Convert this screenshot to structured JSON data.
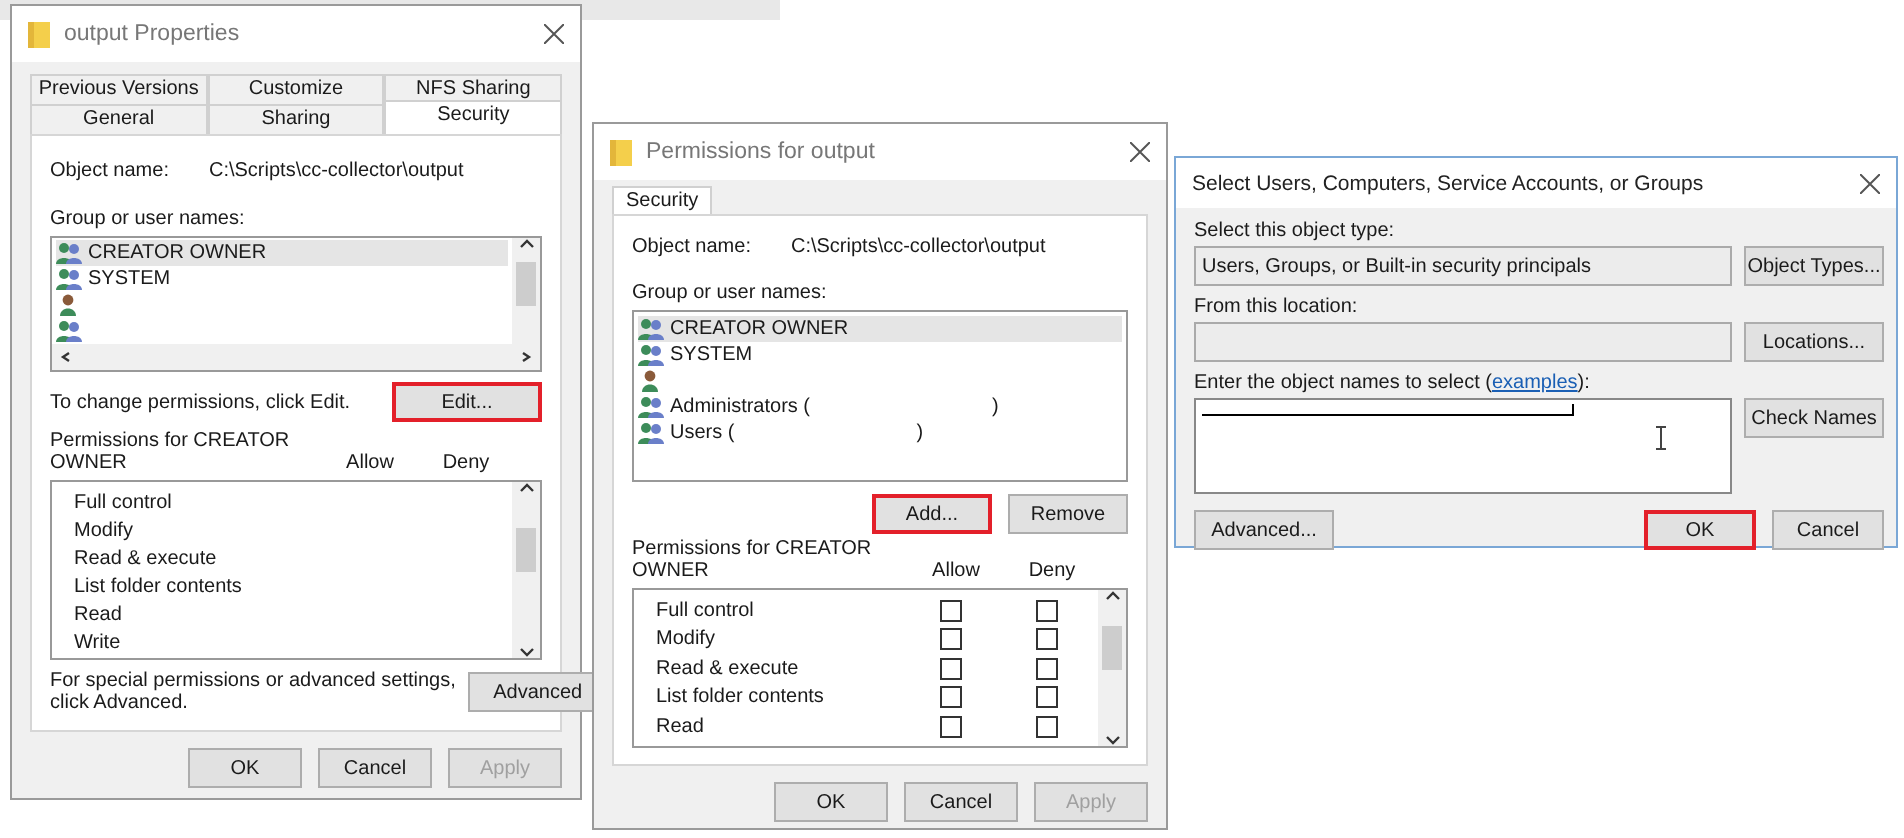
{
  "properties_dialog": {
    "title": "output Properties",
    "tab_rows": [
      [
        {
          "label": "Previous Versions",
          "selected": false
        },
        {
          "label": "Customize",
          "selected": false
        },
        {
          "label": "NFS Sharing",
          "selected": false
        }
      ],
      [
        {
          "label": "General",
          "selected": false
        },
        {
          "label": "Sharing",
          "selected": false
        },
        {
          "label": "Security",
          "selected": true
        }
      ]
    ],
    "object_name_label": "Object name:",
    "object_name": "C:\\Scripts\\cc-collector\\output",
    "group_label": "Group or user names:",
    "principals": [
      {
        "kind": "group",
        "name": "CREATOR OWNER",
        "selected": true
      },
      {
        "kind": "group",
        "name": "SYSTEM",
        "selected": false
      },
      {
        "kind": "user",
        "selected": false
      },
      {
        "kind": "group",
        "selected": false
      }
    ],
    "change_hint": "To change permissions, click Edit.",
    "edit_button": {
      "label": "Edit...",
      "highlighted": true
    },
    "permissions_label": "Permissions for CREATOR\nOWNER",
    "allow_header": "Allow",
    "deny_header": "Deny",
    "permissions": [
      {
        "name": "Full control"
      },
      {
        "name": "Modify"
      },
      {
        "name": "Read & execute"
      },
      {
        "name": "List folder contents"
      },
      {
        "name": "Read"
      },
      {
        "name": "Write"
      }
    ],
    "advanced_hint": "For special permissions or advanced settings,\nclick Advanced.",
    "advanced_button": "Advanced",
    "buttons": [
      {
        "label": "OK",
        "disabled": false
      },
      {
        "label": "Cancel",
        "disabled": false
      },
      {
        "label": "Apply",
        "disabled": true
      }
    ]
  },
  "permissions_dialog": {
    "title": "Permissions for output",
    "tab": {
      "label": "Security",
      "selected": true
    },
    "object_name_label": "Object name:",
    "object_name": "C:\\Scripts\\cc-collector\\output",
    "group_label": "Group or user names:",
    "principals": [
      {
        "kind": "group",
        "name": "CREATOR OWNER",
        "selected": true
      },
      {
        "kind": "group",
        "name": "SYSTEM",
        "selected": false
      },
      {
        "kind": "user",
        "selected": false
      },
      {
        "kind": "group",
        "name": "Administrators (",
        "name_end": ")",
        "selected": false
      },
      {
        "kind": "group",
        "name": "Users (",
        "name_end": ")",
        "selected": false
      }
    ],
    "add_button": {
      "label": "Add...",
      "highlighted": true
    },
    "remove_button": {
      "label": "Remove",
      "highlighted": false
    },
    "permissions_label": "Permissions for CREATOR\nOWNER",
    "allow_header": "Allow",
    "deny_header": "Deny",
    "permissions": [
      {
        "name": "Full control",
        "allow": false,
        "deny": false
      },
      {
        "name": "Modify",
        "allow": false,
        "deny": false
      },
      {
        "name": "Read & execute",
        "allow": false,
        "deny": false
      },
      {
        "name": "List folder contents",
        "allow": false,
        "deny": false
      },
      {
        "name": "Read",
        "allow": false,
        "deny": false
      }
    ],
    "buttons": [
      {
        "label": "OK",
        "disabled": false
      },
      {
        "label": "Cancel",
        "disabled": false
      },
      {
        "label": "Apply",
        "disabled": true
      }
    ]
  },
  "select_dialog": {
    "title": "Select Users, Computers, Service Accounts, or Groups",
    "object_type_label": "Select this object type:",
    "object_type": "Users, Groups, or Built-in security principals",
    "object_types_button": "Object Types...",
    "location_label": "From this location:",
    "locations_button": "Locations...",
    "names_label": "Enter the object names to select (",
    "names_link": "examples",
    "names_label_end": "):",
    "names_redacted": true,
    "check_names_button": "Check Names",
    "advanced_button": "Advanced...",
    "ok_button": {
      "label": "OK",
      "highlighted": true
    },
    "cancel_button": "Cancel"
  }
}
